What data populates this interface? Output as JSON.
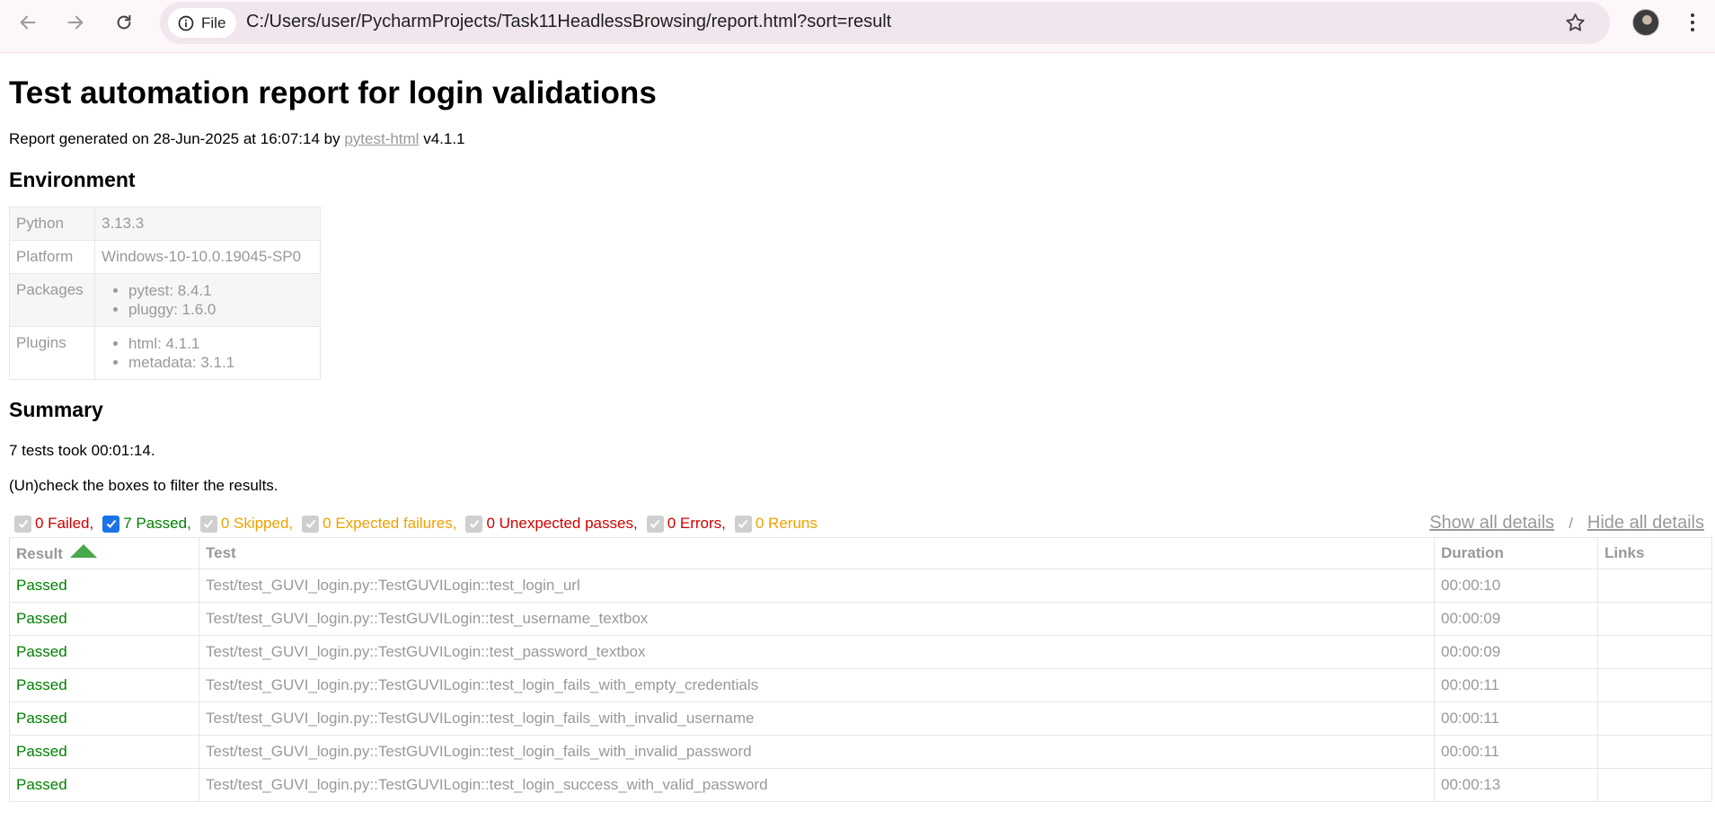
{
  "browser": {
    "chip_label": "File",
    "url": "C:/Users/user/PycharmProjects/Task11HeadlessBrowsing/report.html?sort=result"
  },
  "report": {
    "title": "Test automation report for login validations",
    "generated_prefix": "Report generated on 28-Jun-2025 at 16:07:14 by ",
    "generated_link": "pytest-html",
    "generated_suffix": " v4.1.1"
  },
  "environment": {
    "heading": "Environment",
    "rows": [
      {
        "key": "Python",
        "value": "3.13.3"
      },
      {
        "key": "Platform",
        "value": "Windows-10-10.0.19045-SP0"
      },
      {
        "key": "Packages",
        "items": [
          "pytest: 8.4.1",
          "pluggy: 1.6.0"
        ]
      },
      {
        "key": "Plugins",
        "items": [
          "html: 4.1.1",
          "metadata: 3.1.1"
        ]
      }
    ]
  },
  "summary": {
    "heading": "Summary",
    "took": "7 tests took 00:01:14.",
    "instructions": "(Un)check the boxes to filter the results."
  },
  "filters": [
    {
      "label": "0 Failed,",
      "color": "#d10000",
      "checked": false
    },
    {
      "label": "7 Passed,",
      "color": "#008000",
      "checked": true
    },
    {
      "label": "0 Skipped,",
      "color": "#f0a000",
      "checked": false
    },
    {
      "label": "0 Expected failures,",
      "color": "#f0a000",
      "checked": false
    },
    {
      "label": "0 Unexpected passes,",
      "color": "#d10000",
      "checked": false
    },
    {
      "label": "0 Errors,",
      "color": "#d10000",
      "checked": false
    },
    {
      "label": "0 Reruns",
      "color": "#f0a000",
      "checked": false
    }
  ],
  "details": {
    "show_all": "Show all details",
    "separator": "/",
    "hide_all": "Hide all details"
  },
  "results_table": {
    "columns": [
      "Result",
      "Test",
      "Duration",
      "Links"
    ],
    "rows": [
      {
        "result": "Passed",
        "test": "Test/test_GUVI_login.py::TestGUVILogin::test_login_url",
        "duration": "00:00:10",
        "links": ""
      },
      {
        "result": "Passed",
        "test": "Test/test_GUVI_login.py::TestGUVILogin::test_username_textbox",
        "duration": "00:00:09",
        "links": ""
      },
      {
        "result": "Passed",
        "test": "Test/test_GUVI_login.py::TestGUVILogin::test_password_textbox",
        "duration": "00:00:09",
        "links": ""
      },
      {
        "result": "Passed",
        "test": "Test/test_GUVI_login.py::TestGUVILogin::test_login_fails_with_empty_credentials",
        "duration": "00:00:11",
        "links": ""
      },
      {
        "result": "Passed",
        "test": "Test/test_GUVI_login.py::TestGUVILogin::test_login_fails_with_invalid_username",
        "duration": "00:00:11",
        "links": ""
      },
      {
        "result": "Passed",
        "test": "Test/test_GUVI_login.py::TestGUVILogin::test_login_fails_with_invalid_password",
        "duration": "00:00:11",
        "links": ""
      },
      {
        "result": "Passed",
        "test": "Test/test_GUVI_login.py::TestGUVILogin::test_login_success_with_valid_password",
        "duration": "00:00:13",
        "links": ""
      }
    ]
  }
}
